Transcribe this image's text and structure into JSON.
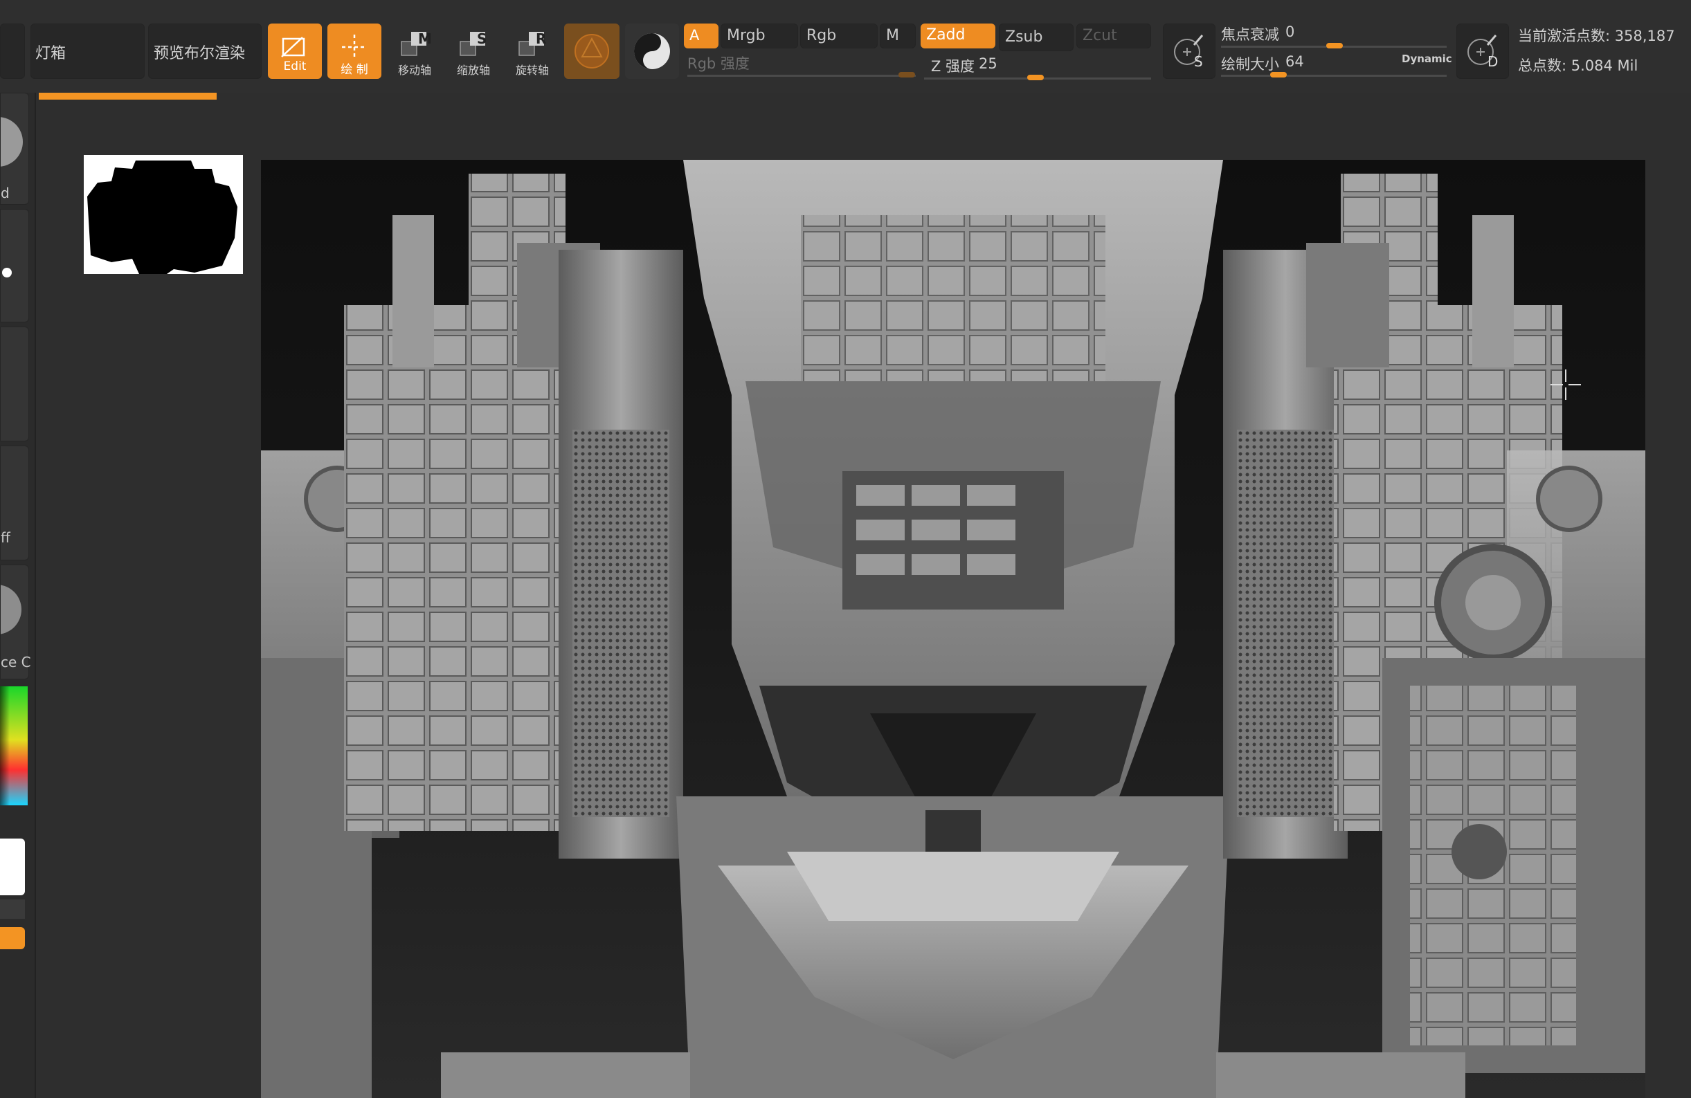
{
  "toolbar": {
    "lightbox_label": "灯箱",
    "preview_boolean_label": "预览布尔渲染",
    "edit_label": "Edit",
    "draw_label": "绘 制",
    "move_label": "移动轴",
    "move_key": "M",
    "scale_label": "缩放轴",
    "scale_key": "S",
    "rotate_label": "旋转轴",
    "rotate_key": "R",
    "a_label": "A",
    "mrgb_label": "Mrgb",
    "rgb_label": "Rgb",
    "m_label": "M",
    "zadd_label": "Zadd",
    "zsub_label": "Zsub",
    "zcut_label": "Zcut",
    "rgb_intensity_label": "Rgb 强度",
    "z_intensity_label": "Z 强度",
    "z_intensity_value": "25",
    "focal_shift_label": "焦点衰减",
    "focal_shift_value": "0",
    "draw_size_label": "绘制大小",
    "draw_size_value": "64",
    "dynamic_label": "Dynamic",
    "s_label": "S",
    "d_label": "D",
    "active_points_label": "当前激活点数:",
    "active_points_value": "358,187",
    "total_points_label": "总点数:",
    "total_points_value": "5.084 Mil"
  },
  "leftpanel": {
    "label_d": "d",
    "label_ff": "ff",
    "label_cec": "ce C"
  },
  "colors": {
    "accent": "#f39423",
    "toolbar_bg": "#2f2f2f",
    "viewport_bg": "#111111"
  },
  "icons": {
    "edit": "edit-icon",
    "draw": "draw-crosshair-icon",
    "move": "move-icon",
    "scale": "scale-icon",
    "rotate": "rotate-icon",
    "material_sphere": "material-sphere-icon",
    "brush_alpha": "brush-alpha-icon",
    "lazy_mouse_s": "lazy-s-icon",
    "lazy_mouse_d": "lazy-d-icon",
    "cursor": "crosshair-cursor-icon"
  }
}
